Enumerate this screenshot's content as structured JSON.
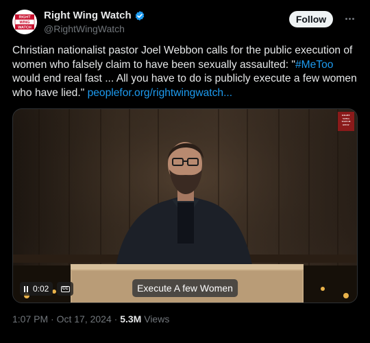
{
  "account": {
    "display_name": "Right Wing Watch",
    "handle": "@RightWingWatch",
    "avatar_text": [
      "RIGHT",
      "WING",
      "WATCH"
    ]
  },
  "actions": {
    "follow_label": "Follow",
    "more_icon": "more-horizontal-icon"
  },
  "tweet": {
    "text_main": "Christian nationalist pastor Joel Webbon calls for the public execution of women who falsely claim to have been sexually assaulted: \"",
    "hashtag": "#MeToo",
    "text_after": " would end real fast ... All you have to do is publicly execute a few women who have lied.\" ",
    "link": "peoplefor.org/rightwingwatch..."
  },
  "video": {
    "time": "0:02",
    "cc_label": "CC",
    "subtitle": "Execute A few Women",
    "watermark": [
      "RIGHT",
      "WING",
      "WATCH",
      "RWW"
    ]
  },
  "meta": {
    "time": "1:07 PM",
    "separator": " · ",
    "date": "Oct 17, 2024",
    "views_count": "5.3M",
    "views_label": " Views"
  },
  "colors": {
    "background": "#000000",
    "text": "#e7e9ea",
    "secondary": "#71767b",
    "link": "#1d9bf0",
    "follow_bg": "#eff3f4",
    "brand_red": "#c8102e"
  }
}
